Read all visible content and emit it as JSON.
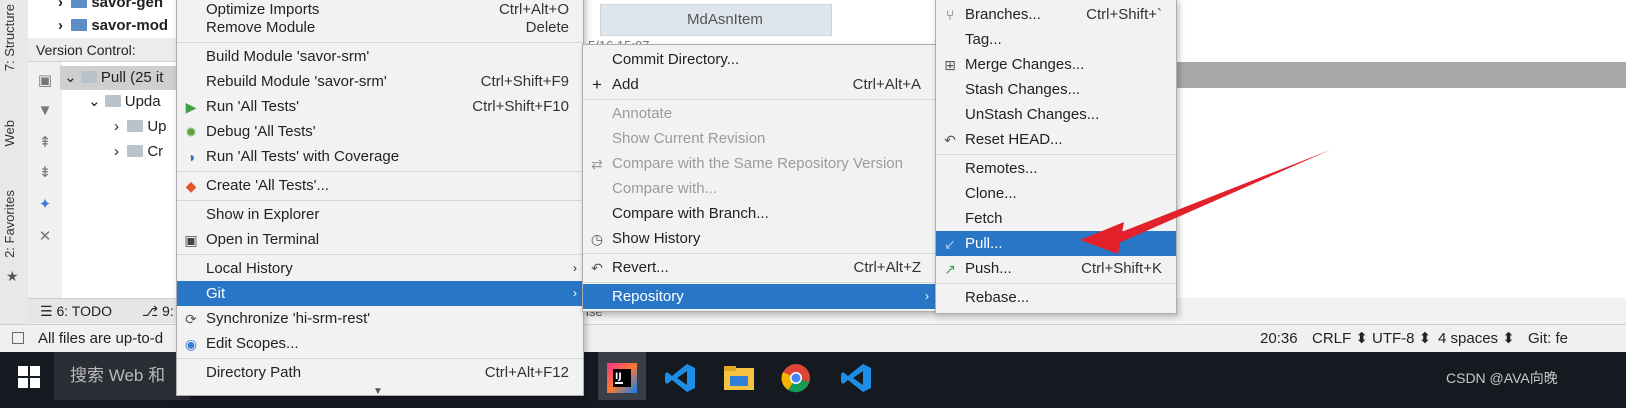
{
  "side_tabs": {
    "structure": "7: Structure",
    "web": "Web",
    "favorites": "2: Favorites"
  },
  "project_tree": {
    "row1": "savor-gen",
    "row2": "savor-mod"
  },
  "version_control": {
    "label": "Version Control:",
    "pull_node": "Pull (25 it",
    "update_node": "Upda",
    "child1": "Up",
    "child2": "Cr"
  },
  "bottom_tabs": {
    "todo": "6: TODO",
    "git": "9:"
  },
  "status": {
    "message": "All files are up-to-d",
    "position": "20:36",
    "line_sep": "CRLF",
    "encoding": "UTF-8",
    "indent": "4 spaces",
    "vcs": "Git: fe"
  },
  "editor": {
    "tab": "MdAsnItem",
    "timestamp": "5/16 15:07",
    "partial_text": "ise"
  },
  "taskbar": {
    "search_placeholder": "搜索 Web 和",
    "watermark": "CSDN @AVA向晚"
  },
  "context_menu": {
    "items": [
      {
        "label": "Optimize Imports",
        "shortcut": "Ctrl+Alt+O"
      },
      {
        "label": "Remove Module",
        "shortcut": "Delete"
      },
      {
        "label": "Build Module 'savor-srm'",
        "shortcut": ""
      },
      {
        "label": "Rebuild Module 'savor-srm'",
        "shortcut": "Ctrl+Shift+F9"
      },
      {
        "label": "Run 'All Tests'",
        "shortcut": "Ctrl+Shift+F10"
      },
      {
        "label": "Debug 'All Tests'",
        "shortcut": ""
      },
      {
        "label": "Run 'All Tests' with Coverage",
        "shortcut": ""
      },
      {
        "label": "Create 'All Tests'...",
        "shortcut": ""
      },
      {
        "label": "Show in Explorer",
        "shortcut": ""
      },
      {
        "label": "Open in Terminal",
        "shortcut": ""
      },
      {
        "label": "Local History",
        "shortcut": ""
      },
      {
        "label": "Git",
        "shortcut": ""
      },
      {
        "label": "Synchronize 'hi-srm-rest'",
        "shortcut": ""
      },
      {
        "label": "Edit Scopes...",
        "shortcut": ""
      },
      {
        "label": "Directory Path",
        "shortcut": "Ctrl+Alt+F12"
      }
    ]
  },
  "git_menu": {
    "items": [
      {
        "label": "Commit Directory...",
        "shortcut": ""
      },
      {
        "label": "Add",
        "shortcut": "Ctrl+Alt+A"
      },
      {
        "label": "Annotate",
        "shortcut": ""
      },
      {
        "label": "Show Current Revision",
        "shortcut": ""
      },
      {
        "label": "Compare with the Same Repository Version",
        "shortcut": ""
      },
      {
        "label": "Compare with...",
        "shortcut": ""
      },
      {
        "label": "Compare with Branch...",
        "shortcut": ""
      },
      {
        "label": "Show History",
        "shortcut": ""
      },
      {
        "label": "Revert...",
        "shortcut": "Ctrl+Alt+Z"
      },
      {
        "label": "Repository",
        "shortcut": ""
      }
    ]
  },
  "repo_menu": {
    "items": [
      {
        "label": "Branches...",
        "shortcut": "Ctrl+Shift+`"
      },
      {
        "label": "Tag...",
        "shortcut": ""
      },
      {
        "label": "Merge Changes...",
        "shortcut": ""
      },
      {
        "label": "Stash Changes...",
        "shortcut": ""
      },
      {
        "label": "UnStash Changes...",
        "shortcut": ""
      },
      {
        "label": "Reset HEAD...",
        "shortcut": ""
      },
      {
        "label": "Remotes...",
        "shortcut": ""
      },
      {
        "label": "Clone...",
        "shortcut": ""
      },
      {
        "label": "Fetch",
        "shortcut": ""
      },
      {
        "label": "Pull...",
        "shortcut": ""
      },
      {
        "label": "Push...",
        "shortcut": "Ctrl+Shift+K"
      },
      {
        "label": "Rebase...",
        "shortcut": ""
      }
    ]
  },
  "colors": {
    "selection": "#2a76c6",
    "annotation_arrow": "#e3212b"
  }
}
